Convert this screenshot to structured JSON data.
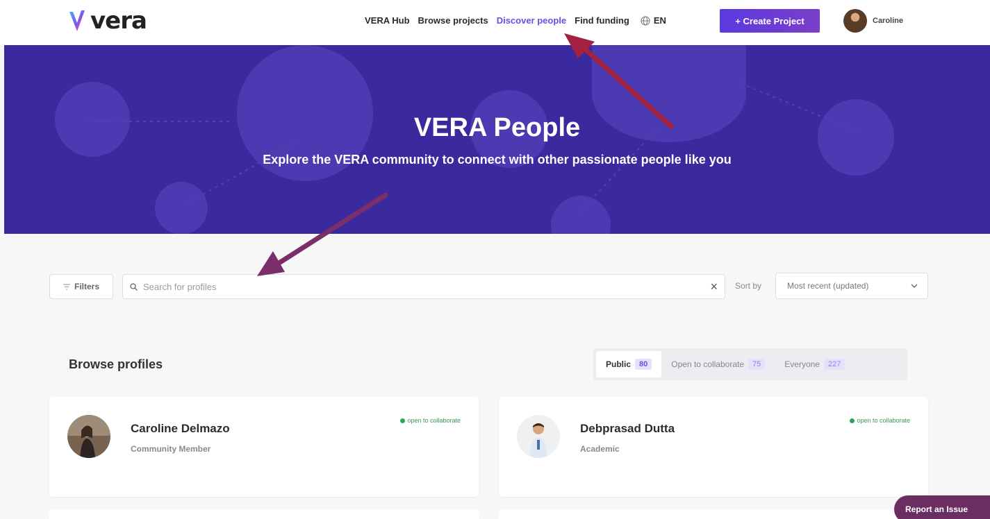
{
  "header": {
    "logo_text": "vera",
    "nav": [
      {
        "label": "VERA Hub"
      },
      {
        "label": "Browse projects"
      },
      {
        "label": "Discover people"
      },
      {
        "label": "Find funding"
      }
    ],
    "active_nav": "Discover people",
    "language": "EN",
    "create_button": "+ Create Project",
    "user_name": "Caroline"
  },
  "hero": {
    "title": "VERA People",
    "subtitle": "Explore the VERA community to connect with other passionate people like you"
  },
  "search": {
    "filters_label": "Filters",
    "placeholder": "Search for profiles",
    "sort_label": "Sort by",
    "sort_value": "Most recent (updated)"
  },
  "browse": {
    "title": "Browse profiles",
    "tabs": [
      {
        "label": "Public",
        "count": "80"
      },
      {
        "label": "Open to collaborate",
        "count": "75"
      },
      {
        "label": "Everyone",
        "count": "227"
      }
    ],
    "active_tab": "Public"
  },
  "profiles": [
    {
      "name": "Caroline Delmazo",
      "role": "Community Member",
      "badge": "open to collaborate"
    },
    {
      "name": "Debprasad Dutta",
      "role": "Academic",
      "badge": "open to collaborate"
    }
  ],
  "report_button": "Report an Issue",
  "colors": {
    "brand_purple": "#6b4de6",
    "hero_bg": "#3a2a9e",
    "annotation_arrow": "#a3223f",
    "collab_green": "#2fa35a",
    "report_bg": "#6b2e63"
  },
  "icons": {
    "globe": "globe-icon",
    "search": "search-icon",
    "clear": "close-icon",
    "filter": "filter-icon",
    "chevron": "chevron-down-icon"
  }
}
